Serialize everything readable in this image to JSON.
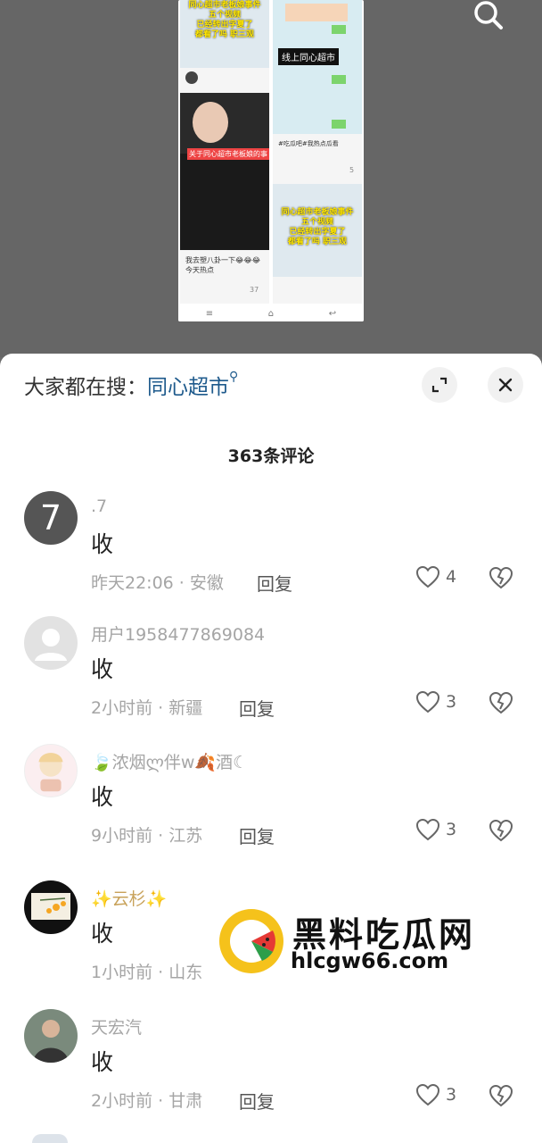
{
  "preview": {
    "banner_top": [
      "同心超市老板娘事件",
      "五个视频",
      "已经转出字夏了",
      "都看了吗 职三观"
    ],
    "tag_right_top": "线上同心超市",
    "tag_left_mid": "关于同心超市老板娘的事",
    "banner_bottom": [
      "同心超市老板娘事件",
      "五个视频",
      "已经转出字夏了",
      "都看了吗 职三观"
    ],
    "caption_left": [
      "我去塑八卦一下😂😂😂",
      "今天热点"
    ],
    "caption_right": [
      "#吃瓜吧#我热点瓜看"
    ],
    "likes_left": "37",
    "likes_right": "5"
  },
  "sheet": {
    "hot_prefix": "大家都在搜：",
    "hot_keyword": "同心超市",
    "comment_count": "363条评论"
  },
  "comments": [
    {
      "avatar_text": "7",
      "name": ".7",
      "text": "收",
      "time": "昨天22:06",
      "region": "安徽",
      "reply": "回复",
      "likes": "4"
    },
    {
      "avatar_text": "",
      "name": "用户1958477869084",
      "text": "收",
      "time": "2小时前",
      "region": "新疆",
      "reply": "回复",
      "likes": "3"
    },
    {
      "avatar_text": "",
      "name": "🍃浓烟ლ伴w🍂酒☾",
      "text": "收",
      "time": "9小时前",
      "region": "江苏",
      "reply": "回复",
      "likes": "3"
    },
    {
      "avatar_text": "",
      "name": "✨云杉✨",
      "text": "收",
      "time": "1小时前",
      "region": "山东",
      "reply": "",
      "likes": ""
    },
    {
      "avatar_text": "",
      "name": "天宏汽",
      "text": "收",
      "time": "2小时前",
      "region": "甘肃",
      "reply": "回复",
      "likes": "3"
    }
  ],
  "watermark": {
    "title": "黑料吃瓜网",
    "url": "hlcgw66.com"
  },
  "colors": {
    "keyword": "#1e5a8c",
    "meta": "#a5a5a5",
    "overlay": "#666666"
  }
}
